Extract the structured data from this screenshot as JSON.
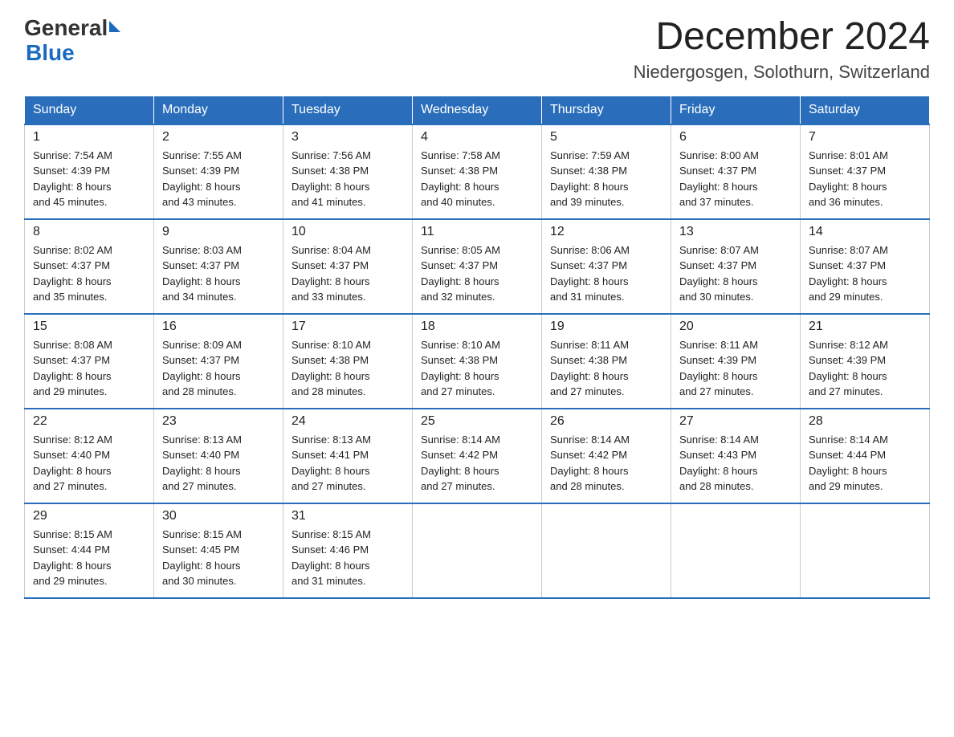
{
  "header": {
    "logo_general": "General",
    "logo_blue": "Blue",
    "month_title": "December 2024",
    "location": "Niedergosgen, Solothurn, Switzerland"
  },
  "days_of_week": [
    "Sunday",
    "Monday",
    "Tuesday",
    "Wednesday",
    "Thursday",
    "Friday",
    "Saturday"
  ],
  "weeks": [
    [
      {
        "day": "1",
        "sunrise": "7:54 AM",
        "sunset": "4:39 PM",
        "daylight": "8 hours and 45 minutes."
      },
      {
        "day": "2",
        "sunrise": "7:55 AM",
        "sunset": "4:39 PM",
        "daylight": "8 hours and 43 minutes."
      },
      {
        "day": "3",
        "sunrise": "7:56 AM",
        "sunset": "4:38 PM",
        "daylight": "8 hours and 41 minutes."
      },
      {
        "day": "4",
        "sunrise": "7:58 AM",
        "sunset": "4:38 PM",
        "daylight": "8 hours and 40 minutes."
      },
      {
        "day": "5",
        "sunrise": "7:59 AM",
        "sunset": "4:38 PM",
        "daylight": "8 hours and 39 minutes."
      },
      {
        "day": "6",
        "sunrise": "8:00 AM",
        "sunset": "4:37 PM",
        "daylight": "8 hours and 37 minutes."
      },
      {
        "day": "7",
        "sunrise": "8:01 AM",
        "sunset": "4:37 PM",
        "daylight": "8 hours and 36 minutes."
      }
    ],
    [
      {
        "day": "8",
        "sunrise": "8:02 AM",
        "sunset": "4:37 PM",
        "daylight": "8 hours and 35 minutes."
      },
      {
        "day": "9",
        "sunrise": "8:03 AM",
        "sunset": "4:37 PM",
        "daylight": "8 hours and 34 minutes."
      },
      {
        "day": "10",
        "sunrise": "8:04 AM",
        "sunset": "4:37 PM",
        "daylight": "8 hours and 33 minutes."
      },
      {
        "day": "11",
        "sunrise": "8:05 AM",
        "sunset": "4:37 PM",
        "daylight": "8 hours and 32 minutes."
      },
      {
        "day": "12",
        "sunrise": "8:06 AM",
        "sunset": "4:37 PM",
        "daylight": "8 hours and 31 minutes."
      },
      {
        "day": "13",
        "sunrise": "8:07 AM",
        "sunset": "4:37 PM",
        "daylight": "8 hours and 30 minutes."
      },
      {
        "day": "14",
        "sunrise": "8:07 AM",
        "sunset": "4:37 PM",
        "daylight": "8 hours and 29 minutes."
      }
    ],
    [
      {
        "day": "15",
        "sunrise": "8:08 AM",
        "sunset": "4:37 PM",
        "daylight": "8 hours and 29 minutes."
      },
      {
        "day": "16",
        "sunrise": "8:09 AM",
        "sunset": "4:37 PM",
        "daylight": "8 hours and 28 minutes."
      },
      {
        "day": "17",
        "sunrise": "8:10 AM",
        "sunset": "4:38 PM",
        "daylight": "8 hours and 28 minutes."
      },
      {
        "day": "18",
        "sunrise": "8:10 AM",
        "sunset": "4:38 PM",
        "daylight": "8 hours and 27 minutes."
      },
      {
        "day": "19",
        "sunrise": "8:11 AM",
        "sunset": "4:38 PM",
        "daylight": "8 hours and 27 minutes."
      },
      {
        "day": "20",
        "sunrise": "8:11 AM",
        "sunset": "4:39 PM",
        "daylight": "8 hours and 27 minutes."
      },
      {
        "day": "21",
        "sunrise": "8:12 AM",
        "sunset": "4:39 PM",
        "daylight": "8 hours and 27 minutes."
      }
    ],
    [
      {
        "day": "22",
        "sunrise": "8:12 AM",
        "sunset": "4:40 PM",
        "daylight": "8 hours and 27 minutes."
      },
      {
        "day": "23",
        "sunrise": "8:13 AM",
        "sunset": "4:40 PM",
        "daylight": "8 hours and 27 minutes."
      },
      {
        "day": "24",
        "sunrise": "8:13 AM",
        "sunset": "4:41 PM",
        "daylight": "8 hours and 27 minutes."
      },
      {
        "day": "25",
        "sunrise": "8:14 AM",
        "sunset": "4:42 PM",
        "daylight": "8 hours and 27 minutes."
      },
      {
        "day": "26",
        "sunrise": "8:14 AM",
        "sunset": "4:42 PM",
        "daylight": "8 hours and 28 minutes."
      },
      {
        "day": "27",
        "sunrise": "8:14 AM",
        "sunset": "4:43 PM",
        "daylight": "8 hours and 28 minutes."
      },
      {
        "day": "28",
        "sunrise": "8:14 AM",
        "sunset": "4:44 PM",
        "daylight": "8 hours and 29 minutes."
      }
    ],
    [
      {
        "day": "29",
        "sunrise": "8:15 AM",
        "sunset": "4:44 PM",
        "daylight": "8 hours and 29 minutes."
      },
      {
        "day": "30",
        "sunrise": "8:15 AM",
        "sunset": "4:45 PM",
        "daylight": "8 hours and 30 minutes."
      },
      {
        "day": "31",
        "sunrise": "8:15 AM",
        "sunset": "4:46 PM",
        "daylight": "8 hours and 31 minutes."
      },
      null,
      null,
      null,
      null
    ]
  ],
  "labels": {
    "sunrise": "Sunrise:",
    "sunset": "Sunset:",
    "daylight": "Daylight:"
  }
}
